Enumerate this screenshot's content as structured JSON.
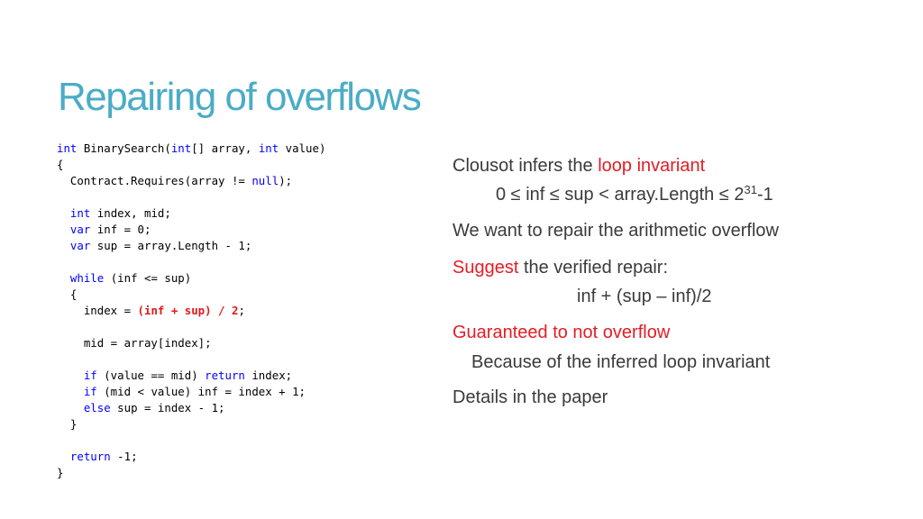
{
  "slide": {
    "title": "Repairing of overflows",
    "accent_color": "#4bacc6",
    "highlight_color": "#e51c23"
  },
  "code": {
    "lines": [
      [
        {
          "t": "int",
          "k": "kw"
        },
        {
          "t": " BinarySearch("
        },
        {
          "t": "int",
          "k": "kw"
        },
        {
          "t": "[] array, "
        },
        {
          "t": "int",
          "k": "kw"
        },
        {
          "t": " value)"
        }
      ],
      [
        {
          "t": "{"
        }
      ],
      [
        {
          "t": "  Contract.Requires(array != "
        },
        {
          "t": "null",
          "k": "kw"
        },
        {
          "t": ");"
        }
      ],
      [],
      [
        {
          "t": "  "
        },
        {
          "t": "int",
          "k": "kw"
        },
        {
          "t": " index, mid;"
        }
      ],
      [
        {
          "t": "  "
        },
        {
          "t": "var",
          "k": "kw"
        },
        {
          "t": " inf = 0;"
        }
      ],
      [
        {
          "t": "  "
        },
        {
          "t": "var",
          "k": "kw"
        },
        {
          "t": " sup = array.Length - 1;"
        }
      ],
      [],
      [
        {
          "t": "  "
        },
        {
          "t": "while",
          "k": "kw"
        },
        {
          "t": " (inf <= sup)"
        }
      ],
      [
        {
          "t": "  {"
        }
      ],
      [
        {
          "t": "    index = "
        },
        {
          "t": "(inf + sup) / 2",
          "k": "hl"
        },
        {
          "t": ";"
        }
      ],
      [],
      [
        {
          "t": "    mid = array[index];"
        }
      ],
      [],
      [
        {
          "t": "    "
        },
        {
          "t": "if",
          "k": "kw"
        },
        {
          "t": " (value == mid) "
        },
        {
          "t": "return",
          "k": "kw"
        },
        {
          "t": " index;"
        }
      ],
      [
        {
          "t": "    "
        },
        {
          "t": "if",
          "k": "kw"
        },
        {
          "t": " (mid < value) inf = index + 1;"
        }
      ],
      [
        {
          "t": "    "
        },
        {
          "t": "else",
          "k": "kw"
        },
        {
          "t": " sup = index - 1;"
        }
      ],
      [
        {
          "t": "  }"
        }
      ],
      [],
      [
        {
          "t": "  "
        },
        {
          "t": "return",
          "k": "kw"
        },
        {
          "t": " -1;"
        }
      ],
      [
        {
          "t": "}"
        }
      ]
    ]
  },
  "bullets": {
    "b1_prefix": "Clousot infers the ",
    "b1_highlight": "loop invariant",
    "b1_sub_main": "0 ≤ inf ≤ sup <  array.Length ≤ 2",
    "b1_sub_exp": "31",
    "b1_sub_tail": "-1",
    "b2": "We want to repair the arithmetic overflow",
    "b3_highlight": "Suggest",
    "b3_rest": " the verified repair:",
    "b3_sub": "inf + (sup – inf)/2",
    "b4_highlight": "Guaranteed to not overflow",
    "b4_sub": "Because of the inferred loop invariant",
    "b5": "Details in the paper"
  }
}
